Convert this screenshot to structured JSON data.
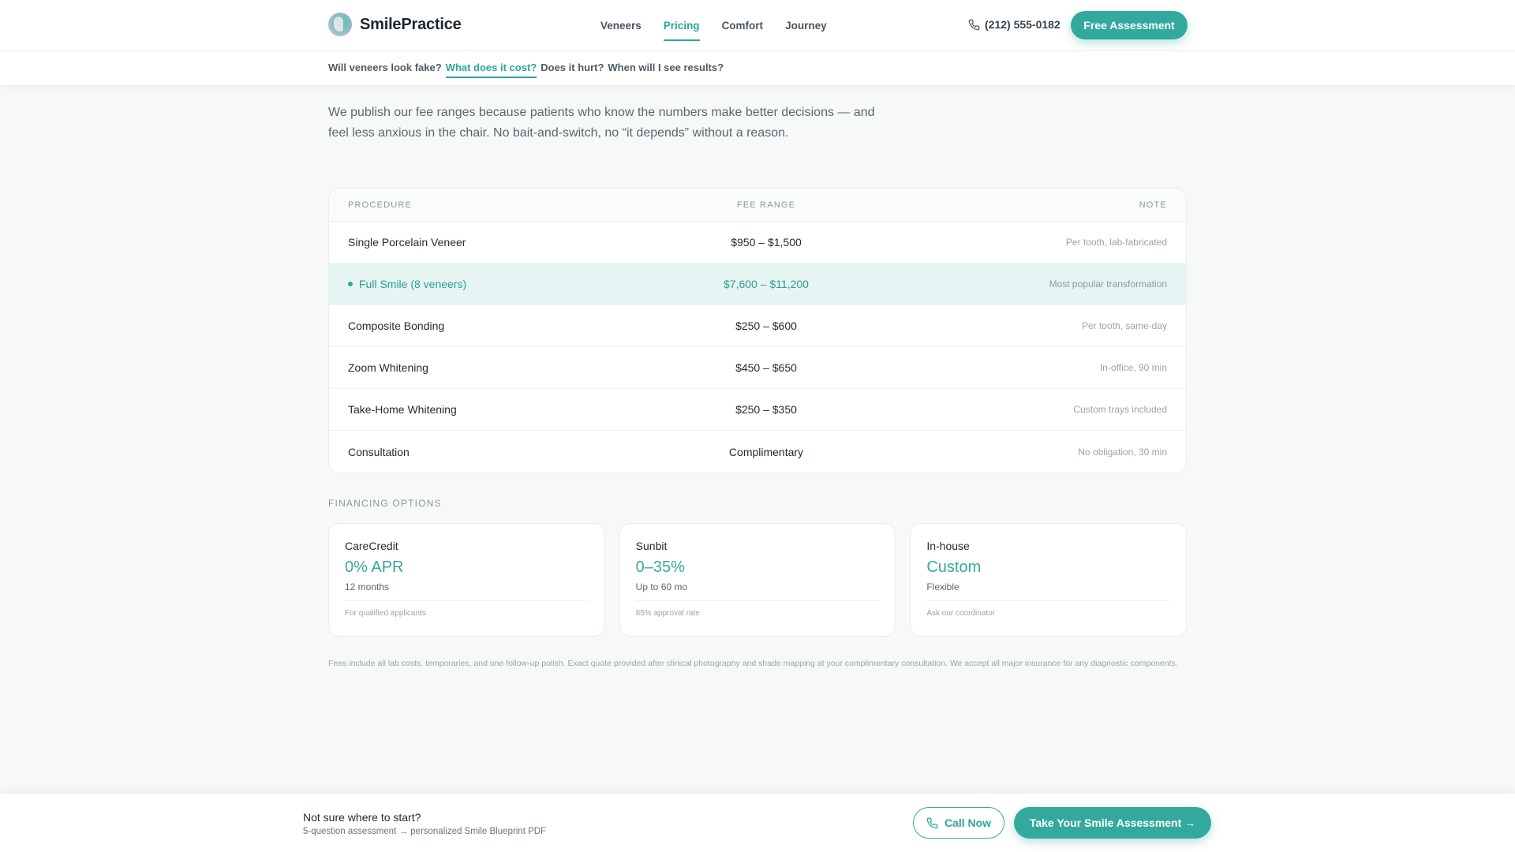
{
  "header": {
    "brand": "SmilePractice",
    "nav": [
      {
        "label": "Veneers"
      },
      {
        "label": "Pricing"
      },
      {
        "label": "Comfort"
      },
      {
        "label": "Journey"
      }
    ],
    "phone": "(212) 555-0182",
    "cta": "Free Assessment"
  },
  "subnav": {
    "questions": [
      {
        "label": "Will veneers look fake?"
      },
      {
        "label": "What does it cost?"
      },
      {
        "label": "Does it hurt?"
      },
      {
        "label": "When will I see results?"
      }
    ],
    "active_index": 1
  },
  "intro": {
    "text": "We publish our fee ranges because patients who know the numbers make better decisions — and feel less anxious in the chair. No bait-and-switch, no “it depends” without a reason."
  },
  "fees": {
    "columns": [
      "PROCEDURE",
      "FEE RANGE",
      "NOTE"
    ],
    "rows": [
      {
        "procedure": "Single Porcelain Veneer",
        "fee": "$950 – $1,500",
        "note": "Per tooth, lab-fabricated"
      },
      {
        "procedure": "Full Smile (8 veneers)",
        "fee": "$7,600 – $11,200",
        "note": "Most popular transformation"
      },
      {
        "procedure": "Composite Bonding",
        "fee": "$250 – $600",
        "note": "Per tooth, same-day"
      },
      {
        "procedure": "Zoom Whitening",
        "fee": "$450 – $650",
        "note": "In-office, 90 min"
      },
      {
        "procedure": "Take-Home Whitening",
        "fee": "$250 – $350",
        "note": "Custom trays included"
      },
      {
        "procedure": "Consultation",
        "fee": "Complimentary",
        "note": "No obligation, 30 min"
      }
    ],
    "highlight_index": 1
  },
  "financing": {
    "label": "FINANCING OPTIONS",
    "cards": [
      {
        "name": "CareCredit",
        "rate": "0% APR",
        "term": "12 months",
        "note": "For qualified applicants"
      },
      {
        "name": "Sunbit",
        "rate": "0–35%",
        "term": "Up to 60 mo",
        "note": "85% approval rate"
      },
      {
        "name": "In-house",
        "rate": "Custom",
        "term": "Flexible",
        "note": "Ask our coordinator"
      }
    ]
  },
  "fineprint": "Fees include all lab costs, temporaries, and one follow-up polish. Exact quote provided after clinical photography and shade mapping at your complimentary consultation. We accept all major insurance for any diagnostic components.",
  "bottombar": {
    "title": "Not sure where to start?",
    "subtitle": "5-question assessment → personalized Smile Blueprint PDF",
    "call_label": "Call Now",
    "assess_label": "Take Your Smile Assessment →"
  },
  "colors": {
    "accent": "#33a99d",
    "highlight_row": "#e6f5f3"
  },
  "icons": {
    "logo": "tooth-logo-icon",
    "phone": "phone-icon"
  }
}
